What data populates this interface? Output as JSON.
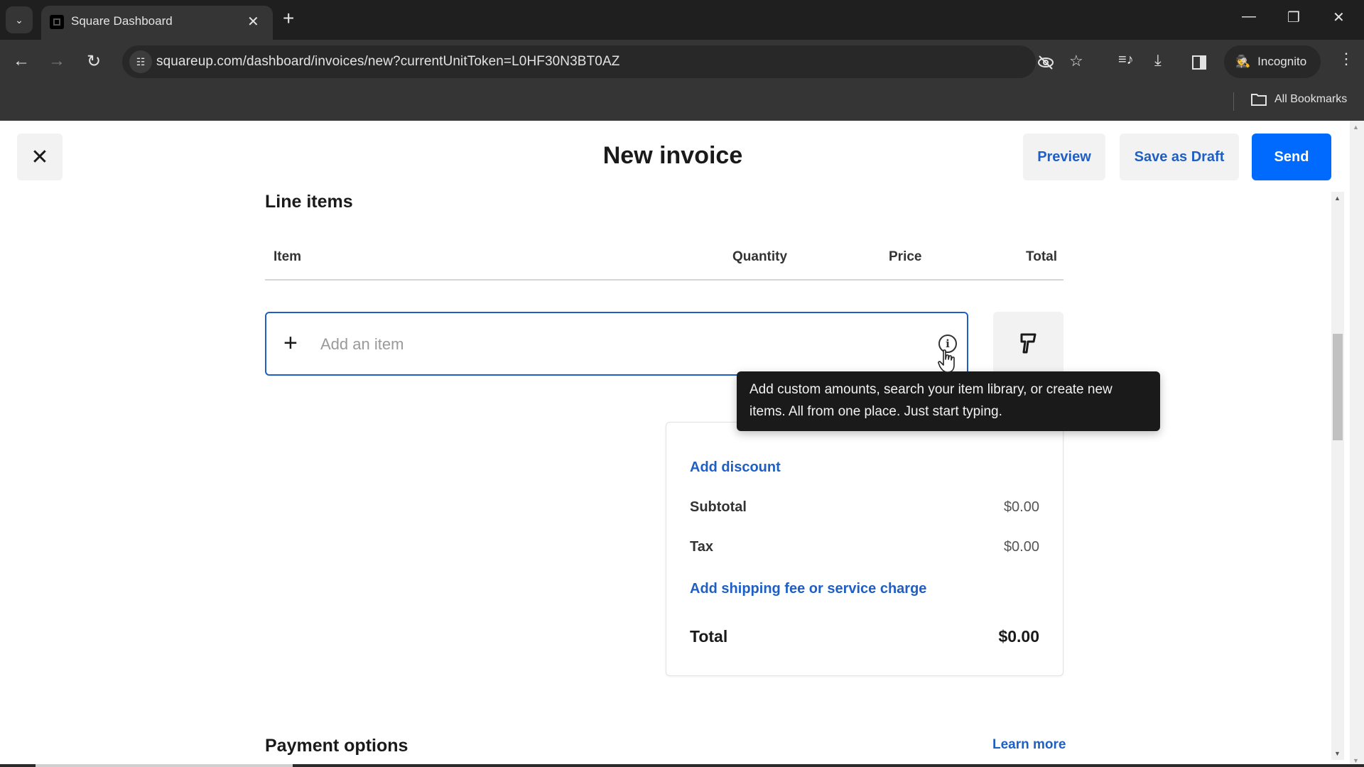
{
  "browser": {
    "tab_title": "Square Dashboard",
    "new_tab_label": "+",
    "url": "squareup.com/dashboard/invoices/new?currentUnitToken=L0HF30N3BT0AZ",
    "profile_label": "Incognito",
    "bookmarks_label": "All Bookmarks",
    "icons": {
      "tab_list": "chevron-down-icon",
      "back": "arrow-left-icon",
      "forward": "arrow-right-icon",
      "reload": "reload-icon",
      "site_info": "tune-icon",
      "eye_off": "eye-off-icon",
      "bookmark": "star-icon",
      "media": "media-queue-icon",
      "download": "download-icon",
      "side_panel": "side-panel-icon",
      "menu": "kebab-menu-icon"
    }
  },
  "header": {
    "title": "New invoice",
    "close_label": "✕",
    "preview_label": "Preview",
    "save_draft_label": "Save as Draft",
    "send_label": "Send"
  },
  "line_items": {
    "title": "Line items",
    "columns": [
      "Item",
      "Quantity",
      "Price",
      "Total"
    ],
    "add_item_placeholder": "Add an item",
    "add_item_value": "",
    "tooltip": "Add custom amounts, search your item library, or create new items. All from one place. Just start typing."
  },
  "summary": {
    "add_discount_label": "Add discount",
    "subtotal_label": "Subtotal",
    "subtotal_value": "$0.00",
    "tax_label": "Tax",
    "tax_value": "$0.00",
    "add_shipping_label": "Add shipping fee or service charge",
    "total_label": "Total",
    "total_value": "$0.00"
  },
  "payment_options": {
    "title": "Payment options",
    "learn_more_label": "Learn more"
  },
  "colors": {
    "accent": "#006aff",
    "link": "#1f5fc4",
    "tooltip_bg": "#1a1a1a"
  }
}
